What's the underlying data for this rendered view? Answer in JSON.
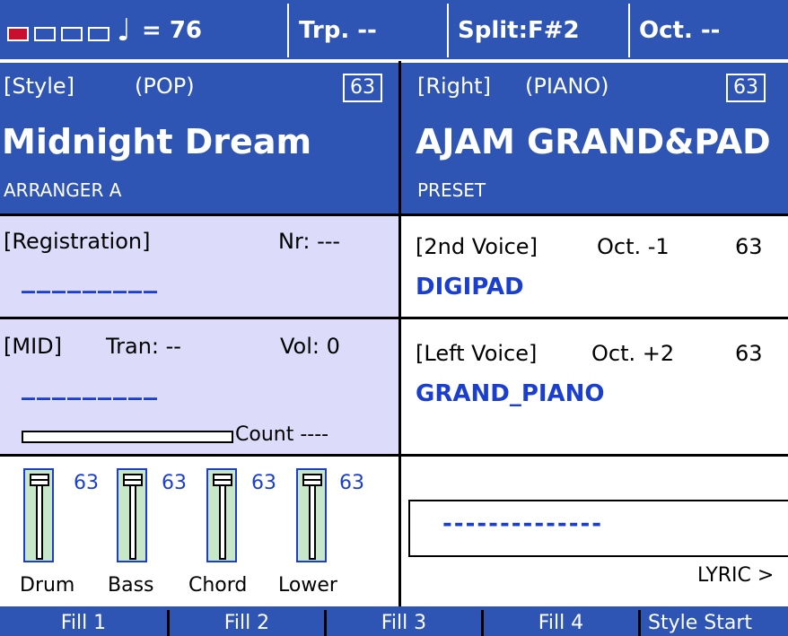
{
  "status_bar": {
    "tempo": "= 76",
    "transpose": "Trp. --",
    "split": "Split:F#2",
    "octave": "Oct. --"
  },
  "style_panel": {
    "header_left": "[Style]",
    "header_category": "(POP)",
    "volume": "63",
    "name": "Midnight Dream",
    "sub": "ARRANGER A"
  },
  "right_panel": {
    "header_left": "[Right]",
    "header_category": "(PIANO)",
    "volume": "63",
    "name": "AJAM GRAND&PAD",
    "sub": "PRESET"
  },
  "registration": {
    "label": "[Registration]",
    "nr": "Nr: ---",
    "value": "_________"
  },
  "second_voice": {
    "label": "[2nd Voice]",
    "octave": "Oct. -1",
    "volume": "63",
    "name": "DIGIPAD"
  },
  "mid": {
    "label": "[MID]",
    "tran": "Tran: --",
    "vol": "Vol:  0",
    "value": "_________",
    "count": "Count  ----"
  },
  "left_voice": {
    "label": "[Left Voice]",
    "octave": "Oct. +2",
    "volume": "63",
    "name": "GRAND_PIANO"
  },
  "mixer": {
    "channels": [
      {
        "label": "Drum",
        "value": "63"
      },
      {
        "label": "Bass",
        "value": "63"
      },
      {
        "label": "Chord",
        "value": "63"
      },
      {
        "label": "Lower",
        "value": "63"
      }
    ]
  },
  "lyric": {
    "value": "--------------",
    "label": "LYRIC >"
  },
  "bottom_buttons": [
    "Fill 1",
    "Fill 2",
    "Fill 3",
    "Fill 4",
    "Style Start"
  ],
  "colors": {
    "panel_blue": "#2e55b4",
    "lavender": "#dcdcfa",
    "accent_text": "#1a3fcf",
    "indicator_red": "#c8102e"
  }
}
